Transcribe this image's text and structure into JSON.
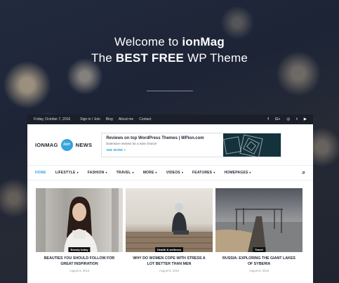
{
  "hero": {
    "welcome_prefix": "Welcome to ",
    "brand": "ionMag",
    "line2_prefix": "The ",
    "line2_bold": "BEST FREE",
    "line2_suffix": " WP Theme"
  },
  "topbar": {
    "date": "Friday, October 7, 2016",
    "links": [
      "Sign in / Join",
      "Blog",
      "About me",
      "Contact"
    ],
    "social": [
      "f",
      "G+",
      "◎",
      "t",
      "▶"
    ]
  },
  "header": {
    "logo_left": "IONMAG",
    "logo_mark": "ion",
    "logo_right": "NEWS",
    "ad": {
      "title": "Reviews on top WordPress Themes | WPion.com",
      "subtitle": "Extensive reviews for a wise choice!",
      "cta": "SEE MORE >"
    }
  },
  "nav": {
    "items": [
      {
        "label": "HOME",
        "dropdown": false
      },
      {
        "label": "LIFESTYLE",
        "dropdown": true
      },
      {
        "label": "FASHION",
        "dropdown": true
      },
      {
        "label": "TRAVEL",
        "dropdown": true
      },
      {
        "label": "MORE",
        "dropdown": true
      },
      {
        "label": "VIDEOS",
        "dropdown": true
      },
      {
        "label": "FEATURES",
        "dropdown": true
      },
      {
        "label": "HOMEPAGES",
        "dropdown": true
      }
    ],
    "caret": "▾",
    "search_icon": "⌕"
  },
  "posts": [
    {
      "category": "Beauty today",
      "title": "BEAUTIES YOU SHOULD FOLLOW FOR GREAT INSPIRATION",
      "date": "August 8, 2016"
    },
    {
      "category": "Health & wellness",
      "title": "WHY DO WOMEN COPE WITH STRESS A LOT BETTER THAN MEN",
      "date": "August 8, 2016"
    },
    {
      "category": "Travel",
      "title": "RUSSIA: EXPLORING THE GIANT LAKES OF SYBERIA",
      "date": "August 8, 2016"
    }
  ],
  "colors": {
    "accent": "#35a3de",
    "topbar": "#1b1f2a",
    "text": "#1e2430"
  }
}
